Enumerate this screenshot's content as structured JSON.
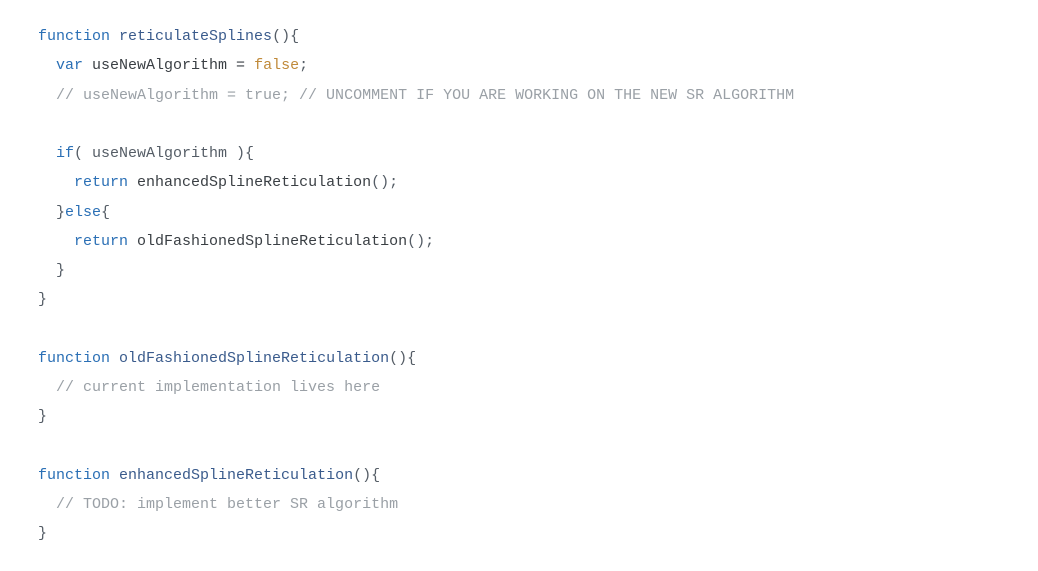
{
  "code": {
    "tokens": [
      [
        {
          "t": "function",
          "c": "kw"
        },
        {
          "t": " ",
          "c": "tx"
        },
        {
          "t": "reticulateSplines",
          "c": "fn"
        },
        {
          "t": "(){",
          "c": "pn"
        }
      ],
      [
        {
          "t": "  ",
          "c": "tx"
        },
        {
          "t": "var",
          "c": "kw"
        },
        {
          "t": " useNewAlgorithm = ",
          "c": "tx"
        },
        {
          "t": "false",
          "c": "lit"
        },
        {
          "t": ";",
          "c": "pn"
        }
      ],
      [
        {
          "t": "  ",
          "c": "tx"
        },
        {
          "t": "// useNewAlgorithm = true; // UNCOMMENT IF YOU ARE WORKING ON THE NEW SR ALGORITHM",
          "c": "cm"
        }
      ],
      [
        {
          "t": "",
          "c": "tx"
        }
      ],
      [
        {
          "t": "  ",
          "c": "tx"
        },
        {
          "t": "if",
          "c": "kw"
        },
        {
          "t": "( useNewAlgorithm ){",
          "c": "pn"
        }
      ],
      [
        {
          "t": "    ",
          "c": "tx"
        },
        {
          "t": "return",
          "c": "kw"
        },
        {
          "t": " ",
          "c": "tx"
        },
        {
          "t": "enhancedSplineReticulation",
          "c": "tx"
        },
        {
          "t": "();",
          "c": "pn"
        }
      ],
      [
        {
          "t": "  }",
          "c": "pn"
        },
        {
          "t": "else",
          "c": "kw"
        },
        {
          "t": "{",
          "c": "pn"
        }
      ],
      [
        {
          "t": "    ",
          "c": "tx"
        },
        {
          "t": "return",
          "c": "kw"
        },
        {
          "t": " ",
          "c": "tx"
        },
        {
          "t": "oldFashionedSplineReticulation",
          "c": "tx"
        },
        {
          "t": "();",
          "c": "pn"
        }
      ],
      [
        {
          "t": "  }",
          "c": "pn"
        }
      ],
      [
        {
          "t": "}",
          "c": "pn"
        }
      ],
      [
        {
          "t": "",
          "c": "tx"
        }
      ],
      [
        {
          "t": "function",
          "c": "kw"
        },
        {
          "t": " ",
          "c": "tx"
        },
        {
          "t": "oldFashionedSplineReticulation",
          "c": "fn"
        },
        {
          "t": "(){",
          "c": "pn"
        }
      ],
      [
        {
          "t": "  ",
          "c": "tx"
        },
        {
          "t": "// current implementation lives here",
          "c": "cm"
        }
      ],
      [
        {
          "t": "}",
          "c": "pn"
        }
      ],
      [
        {
          "t": "",
          "c": "tx"
        }
      ],
      [
        {
          "t": "function",
          "c": "kw"
        },
        {
          "t": " ",
          "c": "tx"
        },
        {
          "t": "enhancedSplineReticulation",
          "c": "fn"
        },
        {
          "t": "(){",
          "c": "pn"
        }
      ],
      [
        {
          "t": "  ",
          "c": "tx"
        },
        {
          "t": "// TODO: implement better SR algorithm",
          "c": "cm"
        }
      ],
      [
        {
          "t": "}",
          "c": "pn"
        }
      ]
    ]
  }
}
